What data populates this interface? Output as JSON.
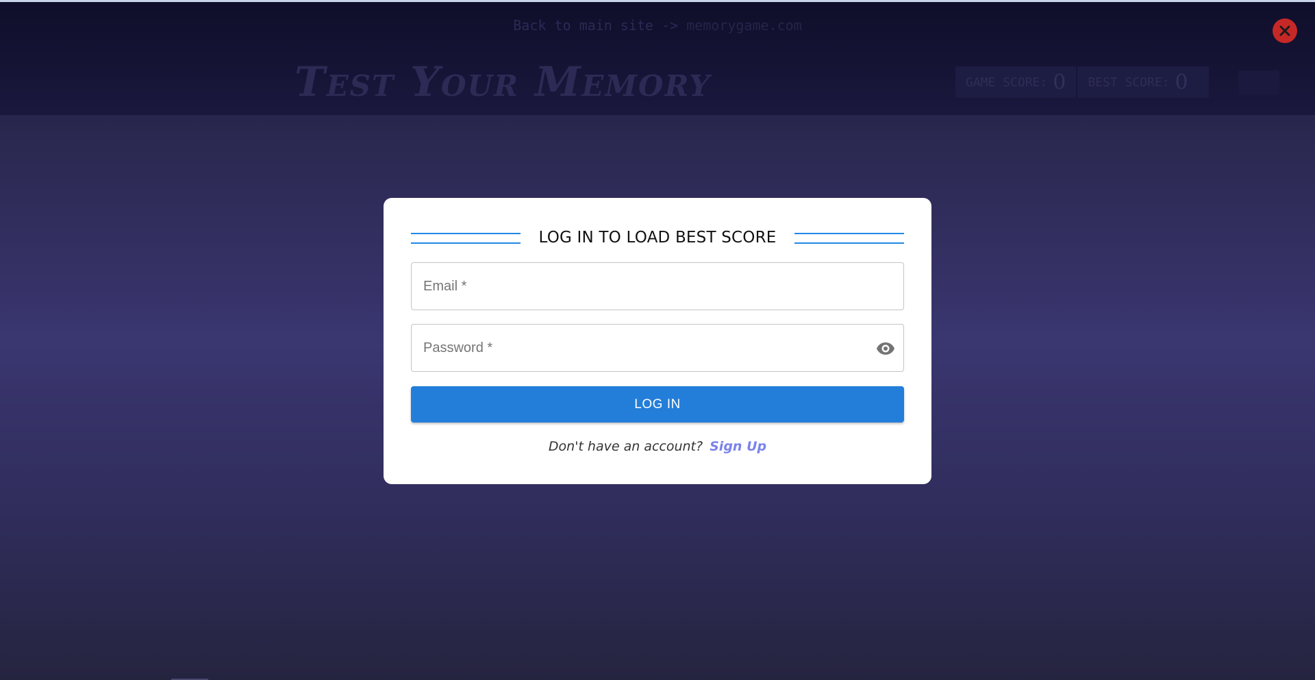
{
  "header": {
    "back_text": "Back to main site ->",
    "back_site": "memorygame.com",
    "title": "Test Your Memory",
    "game_score_label": "GAME SCORE:",
    "game_score_value": "0",
    "best_score_label": "BEST SCORE:",
    "best_score_value": "0"
  },
  "modal": {
    "heading": "LOG IN TO LOAD BEST SCORE",
    "email_placeholder": "Email *",
    "password_placeholder": "Password *",
    "login_label": "LOG IN",
    "signup_prompt": "Don't have an account?",
    "signup_link": "Sign Up"
  },
  "icons": {
    "close": "close-icon",
    "visibility": "eye-icon"
  },
  "colors": {
    "accent": "#237ed9",
    "link": "#7b83eb",
    "close": "#c62828"
  }
}
